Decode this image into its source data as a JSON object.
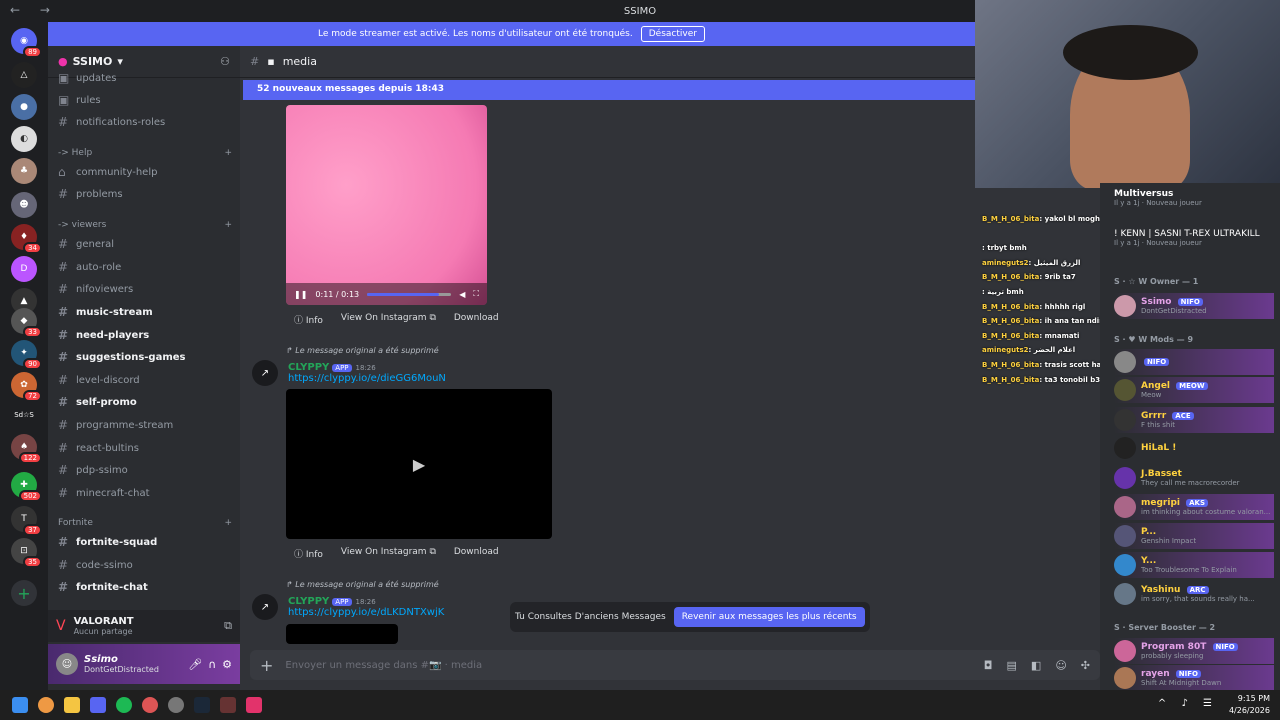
{
  "window": {
    "title": "SSIMO"
  },
  "streamer_banner": {
    "text": "Le mode streamer est activé. Les noms d'utilisateur ont été tronqués.",
    "button": "Désactiver"
  },
  "server_rail": {
    "badges": [
      "89",
      "34",
      "33",
      "90",
      "72",
      "Sd☆S",
      "122",
      "502",
      "37",
      "35"
    ]
  },
  "sidebar": {
    "server_name": "SSIMO",
    "channels_top": [
      {
        "name": "updates"
      },
      {
        "name": "rules"
      },
      {
        "name": "notifications-roles"
      }
    ],
    "cat_help": "-> Help",
    "help_channels": [
      {
        "name": "community-help"
      },
      {
        "name": "problems"
      }
    ],
    "cat_viewers": "-> viewers",
    "viewer_channels": [
      {
        "name": "general"
      },
      {
        "name": "auto-role"
      },
      {
        "name": "nifoviewers"
      },
      {
        "name": "music-stream"
      },
      {
        "name": "need-players"
      },
      {
        "name": "suggestions-games"
      },
      {
        "name": "level-discord"
      },
      {
        "name": "self-promo"
      },
      {
        "name": "programme-stream"
      },
      {
        "name": "react-bultins"
      },
      {
        "name": "pdp-ssimo"
      },
      {
        "name": "minecraft-chat"
      }
    ],
    "cat_fortnite": "Fortnite",
    "fortnite_channels": [
      {
        "name": "fortnite-squad"
      },
      {
        "name": "code-ssimo"
      },
      {
        "name": "fortnite-chat"
      }
    ]
  },
  "voice": {
    "game": "VALORANT",
    "status": "Aucun partage"
  },
  "user": {
    "name": "Ssimo",
    "status": "DontGetDistracted"
  },
  "channel": {
    "name": "media"
  },
  "chat": {
    "new_messages": "52 nouveaux messages depuis 18:43",
    "video1": {
      "time": "0:11 / 0:13",
      "progress": 0.85
    },
    "actions": {
      "info": "Info",
      "view": "View On Instagram",
      "download": "Download"
    },
    "deleted": "Le message original a été supprimé",
    "msg1": {
      "author": "CLYPPY",
      "badge": "APP",
      "time": "18:26",
      "link": "https://clyppy.io/e/dieGG6MouN"
    },
    "msg2": {
      "author": "CLYPPY",
      "badge": "APP",
      "time": "18:26",
      "link": "https://clyppy.io/e/dLKDNTXwjK"
    },
    "old_notice": "Tu Consultes D'anciens Messages",
    "jump": "Revenir aux messages les plus récents",
    "input_placeholder": "Envoyer un message dans #📷 · media"
  },
  "overlay_chat": [
    {
      "user": "",
      "text": ""
    },
    {
      "user": "",
      "text": ""
    },
    {
      "user": "B_M_H_06_bita",
      "text": ": yakol bl moghorfa hhh"
    },
    {
      "user": "",
      "text": ""
    },
    {
      "user": "",
      "text": ": trbyt bmh"
    },
    {
      "user": "amineguts2",
      "text": ": الزرق الميثيل"
    },
    {
      "user": "B_M_H_06_bita",
      "text": ": 9rib ta7"
    },
    {
      "user": "",
      "text": ": تربية bmh"
    },
    {
      "user": "B_M_H_06_bita",
      "text": ": hhhhh rigl"
    },
    {
      "user": "B_M_H_06_bita",
      "text": ": ih ana tan ndirha"
    },
    {
      "user": "B_M_H_06_bita",
      "text": ": mnamati"
    },
    {
      "user": "amineguts2",
      "text": ": اعلام الحضر"
    },
    {
      "user": "B_M_H_06_bita",
      "text": ": trasis scott hada"
    },
    {
      "user": "B_M_H_06_bita",
      "text": ": ta3 tonobil b3atha lya"
    }
  ],
  "members": {
    "top": [
      {
        "name": "Multiversus",
        "status": "Il y a 1j · Nouveau joueur"
      },
      {
        "name": "! KENN | SASNI T-REX ULTRAKILL",
        "status": "Il y a 1j · Nouveau joueur"
      }
    ],
    "owner_group": "S · ☆ W Owner — 1",
    "owner": {
      "name": "Ssimo",
      "tag": "NIFO",
      "status": "DontGetDistracted"
    },
    "mods_group": "S · ♥ W Mods — 9",
    "mods": [
      {
        "name": "",
        "tag": "NIFO",
        "status": ""
      },
      {
        "name": "Angel",
        "tag": "MEOW",
        "status": "Meow"
      },
      {
        "name": "Grrrr",
        "tag": "ACE",
        "status": "F this shit"
      },
      {
        "name": "HiLaL !",
        "tag": "",
        "status": ""
      },
      {
        "name": "J.Basset",
        "tag": "",
        "status": "They call me macrorecorder"
      },
      {
        "name": "megripi",
        "tag": "AKS",
        "status": "im thinking about costume valoran..."
      },
      {
        "name": "P...",
        "tag": "",
        "status": "Genshin Impact"
      },
      {
        "name": "Y...",
        "tag": "",
        "status": "Too Troublesome To Explain"
      },
      {
        "name": "Yashinu",
        "tag": "ARC",
        "status": "im sorry, that sounds really ha..."
      }
    ],
    "booster_group": "S · Server Booster — 2",
    "boosters": [
      {
        "name": "Program 80T",
        "tag": "NIFO",
        "status": "probably sleeping"
      },
      {
        "name": "rayen",
        "tag": "NIFO",
        "status": "Shift At Midnight Dawn"
      }
    ]
  },
  "taskbar": {
    "time": "9:15 PM",
    "date": "4/26/2026"
  }
}
